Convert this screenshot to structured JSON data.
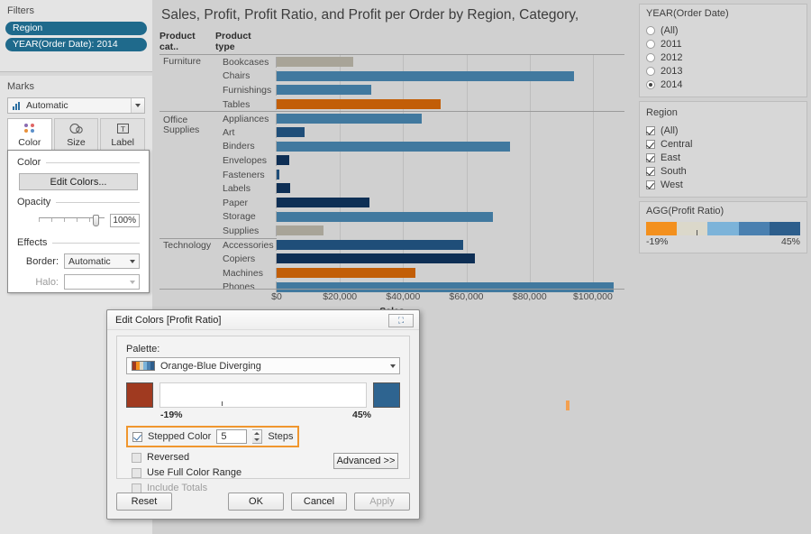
{
  "left": {
    "filters": {
      "title": "Filters",
      "pills": [
        "Region",
        "YEAR(Order Date): 2014"
      ]
    },
    "marks": {
      "title": "Marks",
      "mark_type": "Automatic",
      "shelves": [
        {
          "label": "Color",
          "icon": "color-dots-icon"
        },
        {
          "label": "Size",
          "icon": "size-circles-icon"
        },
        {
          "label": "Label",
          "icon": "label-text-icon"
        }
      ]
    },
    "color_popup": {
      "color_section": "Color",
      "edit_colors_button": "Edit Colors...",
      "opacity_section": "Opacity",
      "opacity_value": "100%",
      "effects_section": "Effects",
      "border_label": "Border:",
      "border_value": "Automatic",
      "halo_label": "Halo:",
      "halo_value": ""
    }
  },
  "viz": {
    "title": "Sales, Profit, Profit Ratio, and Profit per Order by Region, Category,",
    "col_headers": [
      "Product cat..",
      "Product type"
    ],
    "axis_title": "Sales",
    "axis_ticks": [
      "$0",
      "$20,000",
      "$40,000",
      "$60,000",
      "$80,000",
      "$100,000"
    ]
  },
  "chart_data": {
    "type": "bar",
    "title": "Sales, Profit, Profit Ratio, and Profit per Order by Region, Category,",
    "xlabel": "Sales",
    "ylabel": "Product type",
    "xlim": [
      0,
      110000
    ],
    "xticks": [
      0,
      20000,
      40000,
      60000,
      80000,
      100000
    ],
    "xtick_labels": [
      "$0",
      "$20,000",
      "$40,000",
      "$60,000",
      "$80,000",
      "$100,000"
    ],
    "grid": true,
    "legend": {
      "title": "AGG(Profit Ratio)",
      "min": "-19%",
      "max": "45%",
      "position": "right"
    },
    "color_encoding": "Profit Ratio (Orange-Blue Diverging, 5 stepped colors)",
    "groups": [
      {
        "category": "Furniture",
        "rows": [
          {
            "product_type": "Bookcases",
            "sales": 24300,
            "color": "#a8a498",
            "color_band": "neutral-tan"
          },
          {
            "product_type": "Chairs",
            "sales": 94000,
            "color": "#41799f",
            "color_band": "medium-blue"
          },
          {
            "product_type": "Furnishings",
            "sales": 30000,
            "color": "#41799f",
            "color_band": "medium-blue"
          },
          {
            "product_type": "Tables",
            "sales": 51800,
            "color": "#c25e07",
            "color_band": "orange"
          }
        ]
      },
      {
        "category": "Office Supplies",
        "rows": [
          {
            "product_type": "Appliances",
            "sales": 45900,
            "color": "#41799f",
            "color_band": "medium-blue"
          },
          {
            "product_type": "Art",
            "sales": 8700,
            "color": "#1f4e79",
            "color_band": "dark-blue"
          },
          {
            "product_type": "Binders",
            "sales": 73700,
            "color": "#41799f",
            "color_band": "medium-blue"
          },
          {
            "product_type": "Envelopes",
            "sales": 3900,
            "color": "#0e2f55",
            "color_band": "darkest-blue"
          },
          {
            "product_type": "Fasteners",
            "sales": 900,
            "color": "#1f4e79",
            "color_band": "dark-blue"
          },
          {
            "product_type": "Labels",
            "sales": 4300,
            "color": "#0e2f55",
            "color_band": "darkest-blue"
          },
          {
            "product_type": "Paper",
            "sales": 29300,
            "color": "#0e2f55",
            "color_band": "darkest-blue"
          },
          {
            "product_type": "Storage",
            "sales": 68300,
            "color": "#41799f",
            "color_band": "medium-blue"
          },
          {
            "product_type": "Supplies",
            "sales": 14800,
            "color": "#a8a498",
            "color_band": "neutral-tan"
          }
        ]
      },
      {
        "category": "Technology",
        "rows": [
          {
            "product_type": "Accessories",
            "sales": 59000,
            "color": "#1f4e79",
            "color_band": "dark-blue"
          },
          {
            "product_type": "Copiers",
            "sales": 62700,
            "color": "#0e2f55",
            "color_band": "darkest-blue"
          },
          {
            "product_type": "Machines",
            "sales": 44000,
            "color": "#c25e07",
            "color_band": "orange"
          },
          {
            "product_type": "Phones",
            "sales": 106500,
            "color": "#41799f",
            "color_band": "medium-blue"
          }
        ]
      }
    ]
  },
  "right": {
    "year_filter": {
      "title": "YEAR(Order Date)",
      "options": [
        "(All)",
        "2011",
        "2012",
        "2013",
        "2014"
      ],
      "selected": "2014"
    },
    "region_filter": {
      "title": "Region",
      "options": [
        "(All)",
        "Central",
        "East",
        "South",
        "West"
      ],
      "checked": [
        "(All)",
        "Central",
        "East",
        "South",
        "West"
      ]
    },
    "legend": {
      "title": "AGG(Profit Ratio)",
      "min_label": "-19%",
      "max_label": "45%",
      "colors": [
        "#f3901d",
        "#dbd8ca",
        "#7cb3d9",
        "#4a80b0",
        "#2d5e8c"
      ]
    }
  },
  "dialog": {
    "title": "Edit Colors [Profit Ratio]",
    "close_label": "⛶",
    "palette_label": "Palette:",
    "palette_value": "Orange-Blue Diverging",
    "ramp_colors": [
      "#f3901d",
      "#dbd8ca",
      "#7cb3d9",
      "#4a80b0",
      "#2d5e8c"
    ],
    "start_swatch": "#a03a20",
    "end_swatch": "#2e6490",
    "range_min": "-19%",
    "range_max": "45%",
    "stepped_color_label": "Stepped Color",
    "steps_value": "5",
    "steps_suffix": "Steps",
    "reversed_label": "Reversed",
    "full_range_label": "Use Full Color Range",
    "include_totals_label": "Include Totals",
    "advanced_label": "Advanced >>",
    "buttons": {
      "reset": "Reset",
      "ok": "OK",
      "cancel": "Cancel",
      "apply": "Apply"
    },
    "highlight_color": "#f0962e"
  }
}
